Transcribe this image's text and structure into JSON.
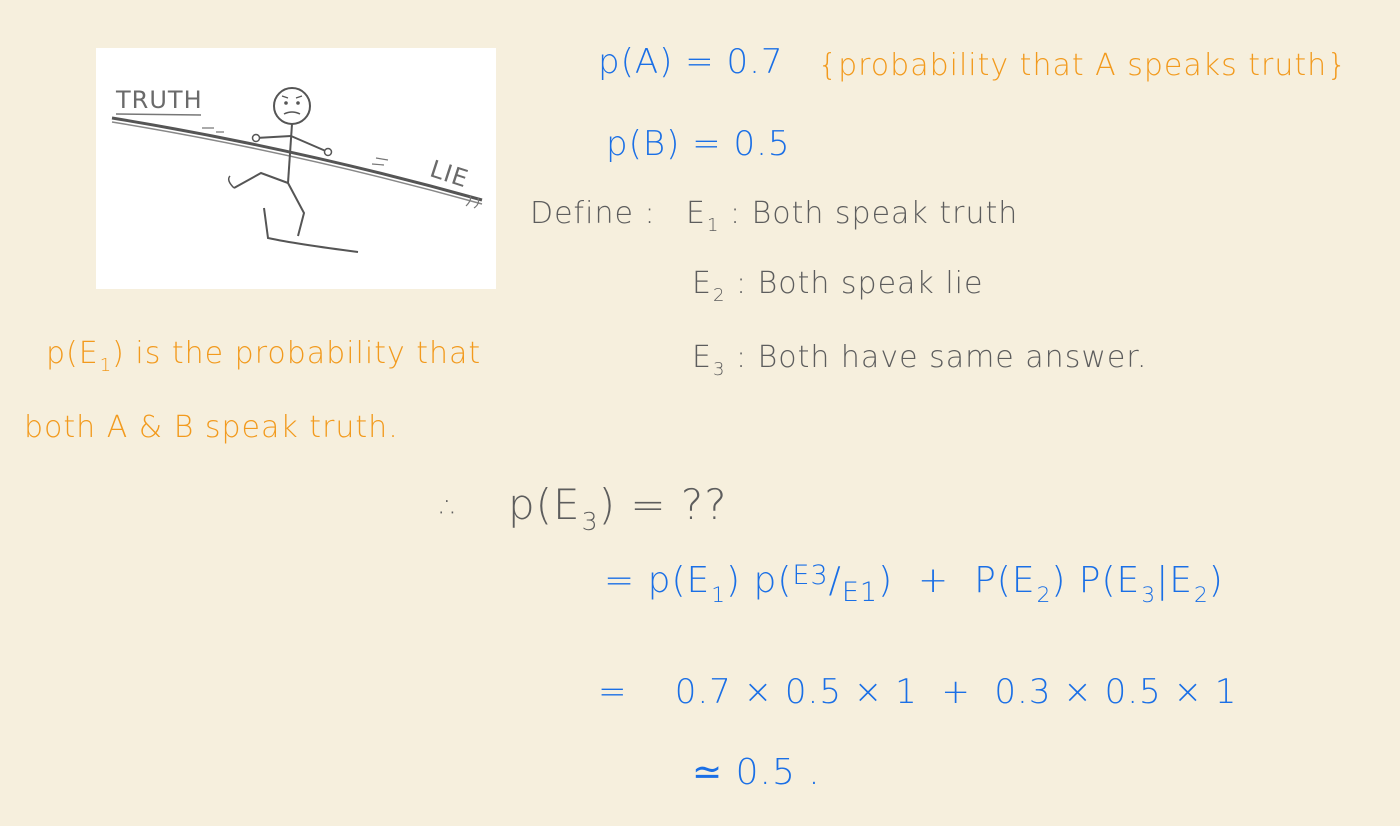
{
  "illustration": {
    "truth_label": "TRUTH",
    "lie_label": "LIE"
  },
  "given": {
    "pa": "p(A) = 0.7",
    "pa_note": "{probability that A speaks truth}",
    "pb": "p(B) = 0.5"
  },
  "define": {
    "label": "Define :",
    "events": [
      {
        "symbol": "E",
        "sub": "1",
        "text": ": Both speak truth"
      },
      {
        "symbol": "E",
        "sub": "2",
        "text": ": Both speak lie"
      },
      {
        "symbol": "E",
        "sub": "3",
        "text": ": Both have same answer."
      }
    ]
  },
  "note": {
    "line1_prefix": "p(E",
    "line1_sub": "1",
    "line1_suffix": ") is the probability that",
    "line2": "both A & B speak truth."
  },
  "solution": {
    "therefore": "∴",
    "question_prefix": "p(E",
    "question_sub": "3",
    "question_suffix": ") = ??",
    "step1": {
      "eq": "=",
      "t1_a": "p(E",
      "t1_sub": "1",
      "t1_b": ") p(",
      "t1_num": "E3",
      "t1_slash": "/",
      "t1_den": "E1",
      "t1_c": ")",
      "plus": "+",
      "t2_a": "P(E",
      "t2_sub": "2",
      "t2_b": ") P(E",
      "t2_sub2": "3",
      "t2_c": "|E",
      "t2_sub3": "2",
      "t2_d": ")"
    },
    "step2": "=    0.7 × 0.5 × 1  +  0.3 × 0.5 × 1",
    "result": "≃ 0.5 ."
  }
}
